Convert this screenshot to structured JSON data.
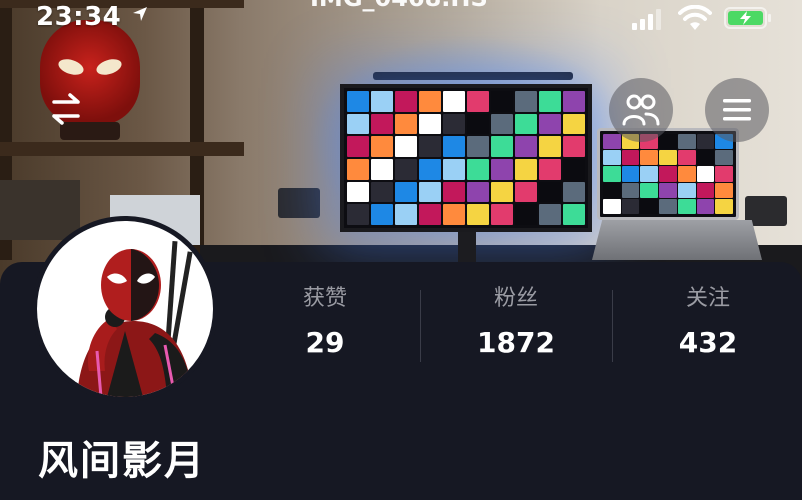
{
  "status_bar": {
    "time": "23:34",
    "partial_text": "IMG_0468.HS",
    "location_icon": "location-arrow-icon",
    "signal_icon": "cellular-signal-icon",
    "wifi_icon": "wifi-icon",
    "battery_icon": "battery-charging-icon",
    "battery_color": "#4cd964"
  },
  "top_actions": {
    "switch_icon": "swap-arrows-icon",
    "friends_icon": "friends-icon",
    "menu_icon": "menu-icon"
  },
  "profile": {
    "nickname": "风间影月",
    "avatar_icon": "avatar-deadpool"
  },
  "stats": [
    {
      "label": "获赞",
      "value": "29"
    },
    {
      "label": "粉丝",
      "value": "1872"
    },
    {
      "label": "关注",
      "value": "432"
    }
  ],
  "colors": {
    "panel_bg": "#161823",
    "label_gray": "#9a9ba3",
    "monitor_glow": "#4682ff"
  }
}
